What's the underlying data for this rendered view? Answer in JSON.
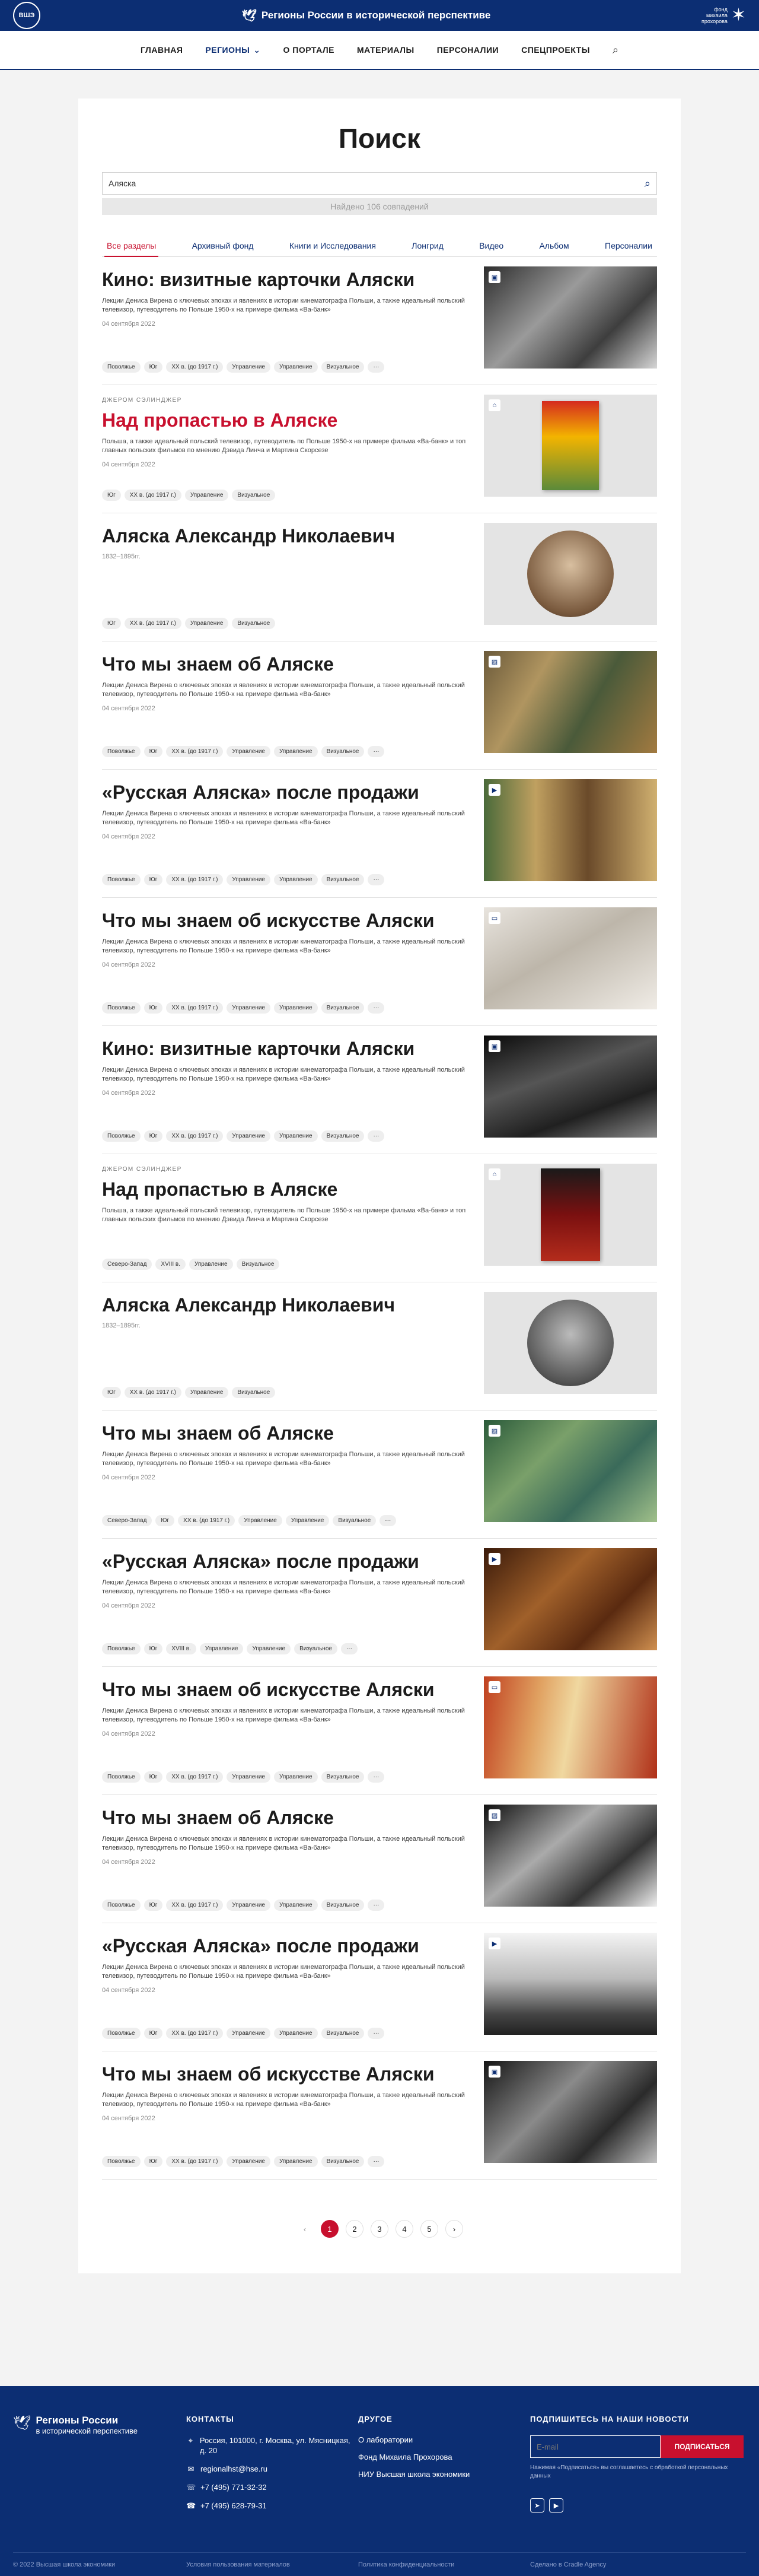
{
  "header": {
    "logo_text": "ВШЭ",
    "site_title": "Регионы России в исторической перспективе",
    "fund_text": "фонд михаила прохорова"
  },
  "nav": {
    "items": [
      "ГЛАВНАЯ",
      "РЕГИОНЫ",
      "О ПОРТАЛЕ",
      "МАТЕРИАЛЫ",
      "ПЕРСОНАЛИИ",
      "СПЕЦПРОЕКТЫ"
    ]
  },
  "search": {
    "title": "Поиск",
    "query": "Аляска",
    "found": "Найдено 106 совпадений"
  },
  "tabs": [
    "Все разделы",
    "Архивный фонд",
    "Книги и Исследования",
    "Лонгрид",
    "Видео",
    "Альбом",
    "Персоналии"
  ],
  "results": [
    {
      "kicker": "",
      "title": "Кино: визитные карточки Аляски",
      "desc": "Лекции Дениса Вирена о ключевых эпохах и явлениях в истории кинематографа Польши, а также идеальный польский телевизор, путеводитель по Польше 1950-х на примере фильма «Ва-банк»",
      "date": "04 сентября 2022",
      "tags": [
        "Поволжье",
        "Юг",
        "XX в. (до 1917 г.)",
        "Управление",
        "Управление",
        "Визуальное",
        "···"
      ],
      "icon": "▣"
    },
    {
      "kicker": "ДЖЕРОМ СЭЛИНДЖЕР",
      "title": "Над пропастью в Аляске",
      "desc": "Польша, а также идеальный польский телевизор, путеводитель по Польше 1950-х на примере фильма «Ва-банк» и топ главных польских фильмов по мнению Дэвида Линча и Мартина Скорсезе",
      "date": "04 сентября 2022",
      "tags": [
        "Юг",
        "XX в. (до 1917 г.)",
        "Управление",
        "Визуальное"
      ],
      "icon": "⌂"
    },
    {
      "kicker": "",
      "title": "Аляска Александр Николаевич",
      "desc": "",
      "date": "1832–1895гг.",
      "tags": [
        "Юг",
        "XX в. (до 1917 г.)",
        "Управление",
        "Визуальное"
      ],
      "icon": ""
    },
    {
      "kicker": "",
      "title": "Что мы знаем об Аляске",
      "desc": "Лекции Дениса Вирена о ключевых эпохах и явлениях в истории кинематографа Польши, а также идеальный польский телевизор, путеводитель по Польше 1950-х на примере фильма «Ва-банк»",
      "date": "04 сентября 2022",
      "tags": [
        "Поволжье",
        "Юг",
        "XX в. (до 1917 г.)",
        "Управление",
        "Управление",
        "Визуальное",
        "···"
      ],
      "icon": "▨"
    },
    {
      "kicker": "",
      "title": "«Русская Аляска» после продажи",
      "desc": "Лекции Дениса Вирена о ключевых эпохах и явлениях в истории кинематографа Польши, а также идеальный польский телевизор, путеводитель по Польше 1950-х на примере фильма «Ва-банк»",
      "date": "04 сентября 2022",
      "tags": [
        "Поволжье",
        "Юг",
        "XX в. (до 1917 г.)",
        "Управление",
        "Управление",
        "Визуальное",
        "···"
      ],
      "icon": "▶"
    },
    {
      "kicker": "",
      "title": "Что мы знаем об искусстве Аляски",
      "desc": "Лекции Дениса Вирена о ключевых эпохах и явлениях в истории кинематографа Польши, а также идеальный польский телевизор, путеводитель по Польше 1950-х на примере фильма «Ва-банк»",
      "date": "04 сентября 2022",
      "tags": [
        "Поволжье",
        "Юг",
        "XX в. (до 1917 г.)",
        "Управление",
        "Управление",
        "Визуальное",
        "···"
      ],
      "icon": "▭"
    },
    {
      "kicker": "",
      "title": "Кино: визитные карточки Аляски",
      "desc": "Лекции Дениса Вирена о ключевых эпохах и явлениях в истории кинематографа Польши, а также идеальный польский телевизор, путеводитель по Польше 1950-х на примере фильма «Ва-банк»",
      "date": "04 сентября 2022",
      "tags": [
        "Поволжье",
        "Юг",
        "XX в. (до 1917 г.)",
        "Управление",
        "Управление",
        "Визуальное",
        "···"
      ],
      "icon": "▣"
    },
    {
      "kicker": "ДЖЕРОМ СЭЛИНДЖЕР",
      "title": "Над пропастью в Аляске",
      "desc": "Польша, а также идеальный польский телевизор, путеводитель по Польше 1950-х на примере фильма «Ва-банк» и топ главных польских фильмов по мнению Дэвида Линча и Мартина Скорсезе",
      "date": "",
      "tags": [
        "Северо-Запад",
        "XVIII в.",
        "Управление",
        "Визуальное"
      ],
      "icon": "⌂"
    },
    {
      "kicker": "",
      "title": "Аляска Александр Николаевич",
      "desc": "",
      "date": "1832–1895гг.",
      "tags": [
        "Юг",
        "XX в. (до 1917 г.)",
        "Управление",
        "Визуальное"
      ],
      "icon": ""
    },
    {
      "kicker": "",
      "title": "Что мы знаем об Аляске",
      "desc": "Лекции Дениса Вирена о ключевых эпохах и явлениях в истории кинематографа Польши, а также идеальный польский телевизор, путеводитель по Польше 1950-х на примере фильма «Ва-банк»",
      "date": "04 сентября 2022",
      "tags": [
        "Северо-Запад",
        "Юг",
        "XX в. (до 1917 г.)",
        "Управление",
        "Управление",
        "Визуальное",
        "···"
      ],
      "icon": "▨"
    },
    {
      "kicker": "",
      "title": "«Русская Аляска» после продажи",
      "desc": "Лекции Дениса Вирена о ключевых эпохах и явлениях в истории кинематографа Польши, а также идеальный польский телевизор, путеводитель по Польше 1950-х на примере фильма «Ва-банк»",
      "date": "04 сентября 2022",
      "tags": [
        "Поволжье",
        "Юг",
        "XVIII в.",
        "Управление",
        "Управление",
        "Визуальное",
        "···"
      ],
      "icon": "▶"
    },
    {
      "kicker": "",
      "title": "Что мы знаем об искусстве Аляски",
      "desc": "Лекции Дениса Вирена о ключевых эпохах и явлениях в истории кинематографа Польши, а также идеальный польский телевизор, путеводитель по Польше 1950-х на примере фильма «Ва-банк»",
      "date": "04 сентября 2022",
      "tags": [
        "Поволжье",
        "Юг",
        "XX в. (до 1917 г.)",
        "Управление",
        "Управление",
        "Визуальное",
        "···"
      ],
      "icon": "▭"
    },
    {
      "kicker": "",
      "title": "Что мы знаем об Аляске",
      "desc": "Лекции Дениса Вирена о ключевых эпохах и явлениях в истории кинематографа Польши, а также идеальный польский телевизор, путеводитель по Польше 1950-х на примере фильма «Ва-банк»",
      "date": "04 сентября 2022",
      "tags": [
        "Поволжье",
        "Юг",
        "XX в. (до 1917 г.)",
        "Управление",
        "Управление",
        "Визуальное",
        "···"
      ],
      "icon": "▨"
    },
    {
      "kicker": "",
      "title": "«Русская Аляска» после продажи",
      "desc": "Лекции Дениса Вирена о ключевых эпохах и явлениях в истории кинематографа Польши, а также идеальный польский телевизор, путеводитель по Польше 1950-х на примере фильма «Ва-банк»",
      "date": "04 сентября 2022",
      "tags": [
        "Поволжье",
        "Юг",
        "XX в. (до 1917 г.)",
        "Управление",
        "Управление",
        "Визуальное",
        "···"
      ],
      "icon": "▶"
    },
    {
      "kicker": "",
      "title": "Что мы знаем об искусстве Аляски",
      "desc": "Лекции Дениса Вирена о ключевых эпохах и явлениях в истории кинематографа Польши, а также идеальный польский телевизор, путеводитель по Польше 1950-х на примере фильма «Ва-банк»",
      "date": "04 сентября 2022",
      "tags": [
        "Поволжье",
        "Юг",
        "XX в. (до 1917 г.)",
        "Управление",
        "Управление",
        "Визуальное",
        "···"
      ],
      "icon": "▣"
    }
  ],
  "pagination": {
    "prev": "‹",
    "pages": [
      "1",
      "2",
      "3",
      "4",
      "5"
    ],
    "next": "›"
  },
  "footer": {
    "logo_title": "Регионы России",
    "logo_sub": "в исторической перспективе",
    "contacts_title": "КОНТАКТЫ",
    "address": "Россия, 101000, г. Москва, ул. Мясницкая, д. 20",
    "email": "regionalhst@hse.ru",
    "phone1": "+7 (495) 771-32-32",
    "phone2": "+7 (495) 628-79-31",
    "other_title": "ДРУГОЕ",
    "links": [
      "О лаборатории",
      "Фонд Михаила Прохорова",
      "НИУ Высшая школа экономики"
    ],
    "subscribe_title": "ПОДПИШИТЕСЬ НА НАШИ НОВОСТИ",
    "email_placeholder": "E-mail",
    "subscribe_button": "ПОДПИСАТЬСЯ",
    "subscribe_note": "Нажимая «Подписаться» вы соглашаетесь с обработкой персональных данных",
    "copyright": "© 2022 Высшая школа экономики",
    "terms": "Условия пользования материалов",
    "privacy": "Политика конфиденциальности",
    "made_by": "Сделано в Cradle Agency"
  }
}
